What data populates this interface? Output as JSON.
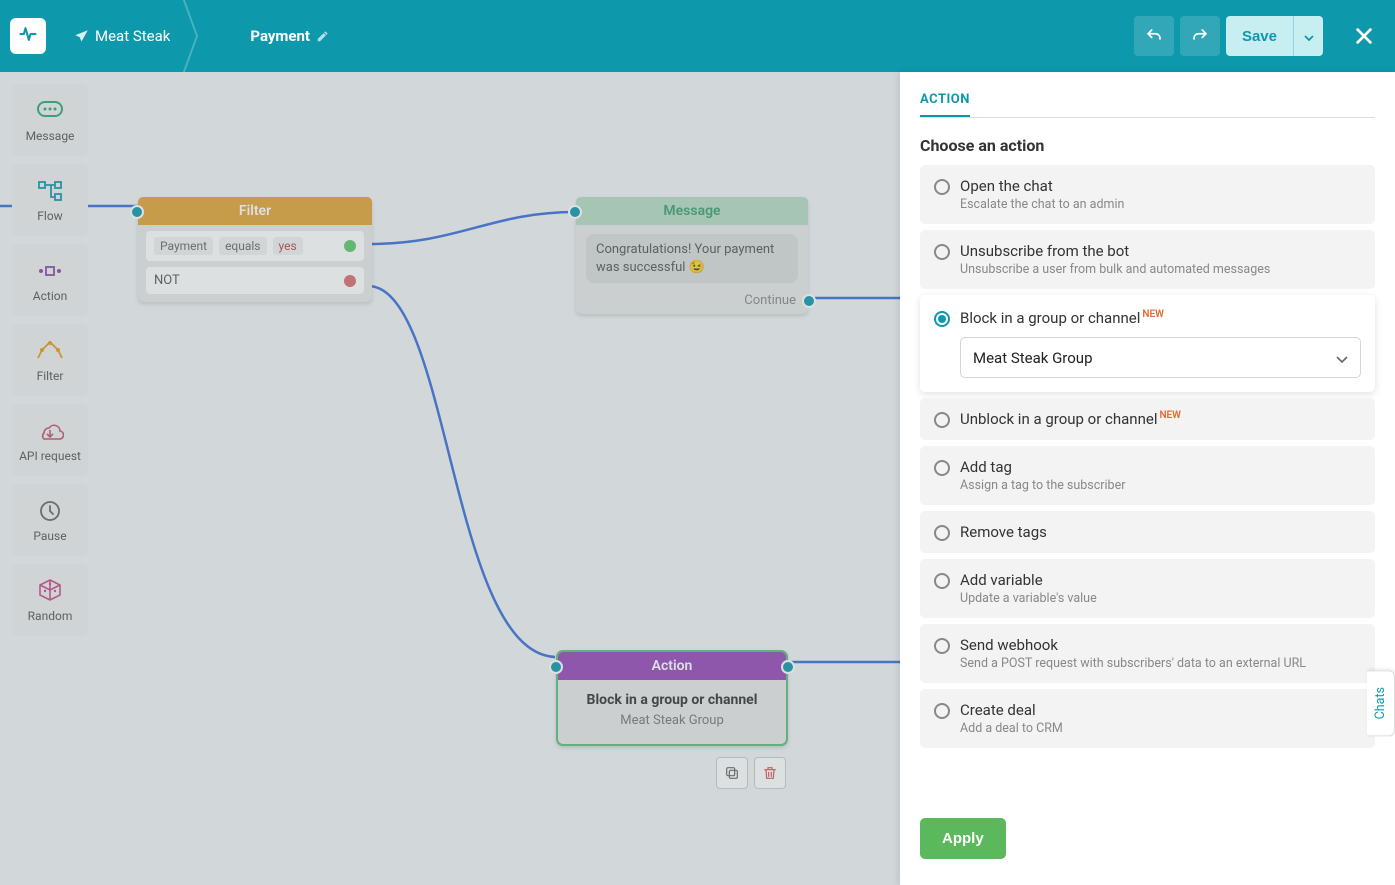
{
  "header": {
    "bot_name": "Meat Steak",
    "flow_name": "Payment",
    "save_label": "Save"
  },
  "sidebar": [
    {
      "label": "Message"
    },
    {
      "label": "Flow"
    },
    {
      "label": "Action"
    },
    {
      "label": "Filter"
    },
    {
      "label": "API request"
    },
    {
      "label": "Pause"
    },
    {
      "label": "Random"
    }
  ],
  "nodes": {
    "filter": {
      "title": "Filter",
      "cond_var": "Payment",
      "cond_op": "equals",
      "cond_val": "yes",
      "else_label": "NOT"
    },
    "message": {
      "title": "Message",
      "text": "Congratulations! Your payment was successful 😉",
      "continue": "Continue"
    },
    "action": {
      "title": "Action",
      "label": "Block in a group or channel",
      "group": "Meat Steak Group"
    }
  },
  "panel": {
    "tab": "ACTION",
    "heading": "Choose an action",
    "selected_group": "Meat Steak Group",
    "apply": "Apply",
    "options": [
      {
        "label": "Open the chat",
        "desc": "Escalate the chat to an admin"
      },
      {
        "label": "Unsubscribe from the bot",
        "desc": "Unsubscribe a user from bulk and automated messages"
      },
      {
        "label": "Block in a group or channel",
        "desc": "",
        "new": true,
        "selected": true
      },
      {
        "label": "Unblock in a group or channel",
        "desc": "",
        "new": true
      },
      {
        "label": "Add tag",
        "desc": "Assign a tag to the subscriber"
      },
      {
        "label": "Remove tags",
        "desc": ""
      },
      {
        "label": "Add variable",
        "desc": "Update a variable's value"
      },
      {
        "label": "Send webhook",
        "desc": "Send a POST request with subscribers' data to an external URL"
      },
      {
        "label": "Create deal",
        "desc": "Add a deal to CRM"
      }
    ]
  },
  "chats_tab": "Chats"
}
